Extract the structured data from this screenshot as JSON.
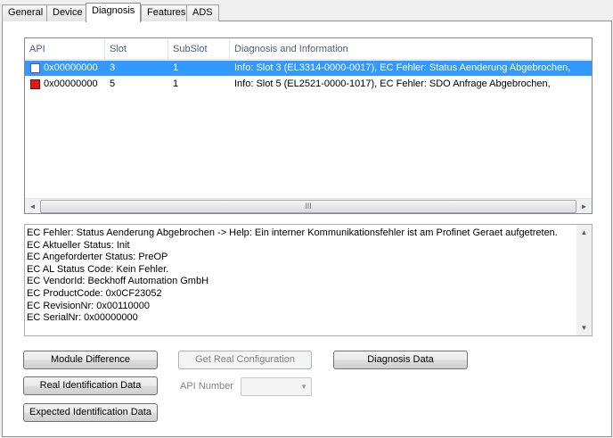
{
  "tabs": [
    {
      "label": "General",
      "active": false
    },
    {
      "label": "Device",
      "active": false
    },
    {
      "label": "Diagnosis",
      "active": true
    },
    {
      "label": "Features",
      "active": false
    },
    {
      "label": "ADS",
      "active": false
    }
  ],
  "diagnosis_list": {
    "columns": [
      "API",
      "Slot",
      "SubSlot",
      "Diagnosis and Information"
    ],
    "rows": [
      {
        "icon": "info-icon",
        "api": "0x00000000",
        "slot": "3",
        "subslot": "1",
        "info": "Info: Slot 3 (EL3314-0000-0017),  EC Fehler: Status Aenderung Abgebrochen,",
        "selected": true
      },
      {
        "icon": "error-icon",
        "api": "0x00000000",
        "slot": "5",
        "subslot": "1",
        "info": "Info: Slot 5 (EL2521-0000-1017),  EC Fehler: SDO Anfrage Abgebrochen,",
        "selected": false
      }
    ],
    "hscroll": {
      "left": "◄",
      "right": "►",
      "grip": "III"
    }
  },
  "details": {
    "lines": [
      "EC Fehler: Status Aenderung Abgebrochen -> Help: Ein interner Kommunikationsfehler ist am Profinet Geraet aufgetreten.",
      "EC Aktueller Status: Init",
      "EC Angeforderter Status: PreOP",
      "EC AL Status Code: Kein Fehler.",
      "EC VendorId: Beckhoff Automation GmbH",
      "EC ProductCode: 0x0CF23052",
      "EC RevisionNr: 0x00110000",
      "EC SerialNr: 0x00000000"
    ],
    "vscroll": {
      "up": "▲",
      "down": "▼"
    }
  },
  "buttons": {
    "module_difference": "Module Difference",
    "get_real_configuration": "Get Real Configuration",
    "diagnosis_data": "Diagnosis Data",
    "real_identification_data": "Real Identification Data",
    "expected_identification_data": "Expected Identification Data"
  },
  "api_number": {
    "label": "API Number",
    "value": "",
    "arrow": "▼"
  }
}
